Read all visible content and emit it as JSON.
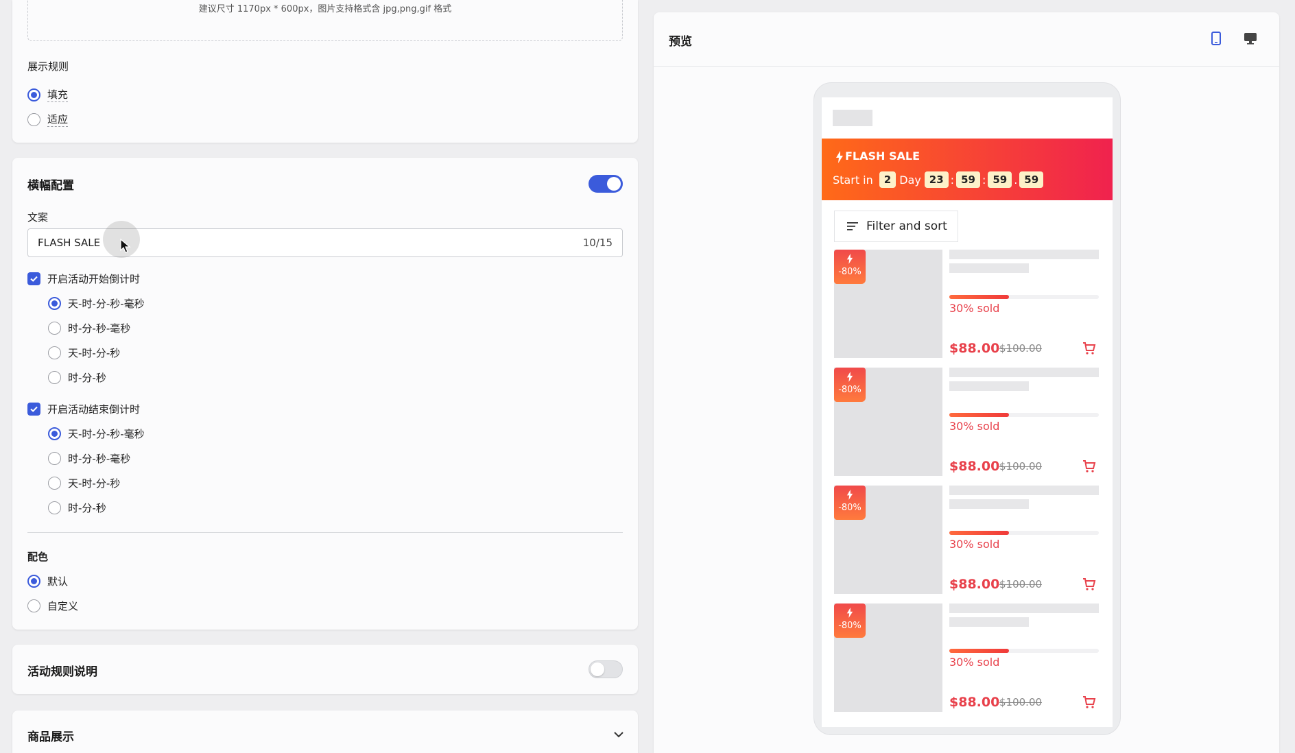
{
  "upload": {
    "hint": "建议尺寸 1170px * 600px，图片支持格式含 jpg,png,gif 格式"
  },
  "display_rule": {
    "title": "展示规则",
    "options": [
      "填充",
      "适应"
    ],
    "selected": 0
  },
  "banner_config": {
    "title": "横幅配置",
    "enabled": true,
    "copy_label": "文案",
    "copy_value": "FLASH SALE",
    "copy_count": "10/15",
    "start_countdown": {
      "label": "开启活动开始倒计时",
      "checked": true,
      "options": [
        "天-时-分-秒-毫秒",
        "时-分-秒-毫秒",
        "天-时-分-秒",
        "时-分-秒"
      ],
      "selected": 0
    },
    "end_countdown": {
      "label": "开启活动结束倒计时",
      "checked": true,
      "options": [
        "天-时-分-秒-毫秒",
        "时-分-秒-毫秒",
        "天-时-分-秒",
        "时-分-秒"
      ],
      "selected": 0
    },
    "color_title": "配色",
    "color_options": [
      "默认",
      "自定义"
    ],
    "color_selected": 0
  },
  "rules_section": {
    "title": "活动规则说明",
    "enabled": false
  },
  "products_section": {
    "title": "商品展示"
  },
  "preview": {
    "title": "预览",
    "banner": {
      "title": "FLASH SALE",
      "start_in": "Start in",
      "days": "2",
      "day_label": "Day",
      "hours": "23",
      "minutes": "59",
      "seconds": "59",
      "ms": "59",
      "sep1": ":",
      "sep2": ":",
      "sep3": "."
    },
    "filter_label": "Filter and sort",
    "products": [
      {
        "discount": "-80%",
        "sold": "30% sold",
        "sold_fraction": 0.4,
        "price": "$88.00",
        "old_price": "$100.00"
      },
      {
        "discount": "-80%",
        "sold": "30% sold",
        "sold_fraction": 0.4,
        "price": "$88.00",
        "old_price": "$100.00"
      },
      {
        "discount": "-80%",
        "sold": "30% sold",
        "sold_fraction": 0.4,
        "price": "$88.00",
        "old_price": "$100.00"
      },
      {
        "discount": "-80%",
        "sold": "30% sold",
        "sold_fraction": 0.4,
        "price": "$88.00",
        "old_price": "$100.00"
      }
    ]
  },
  "colors": {
    "accent": "#3b5bdb",
    "sale_red": "#e8414b",
    "banner_start": "#ff6a18",
    "banner_end": "#f0224e"
  }
}
